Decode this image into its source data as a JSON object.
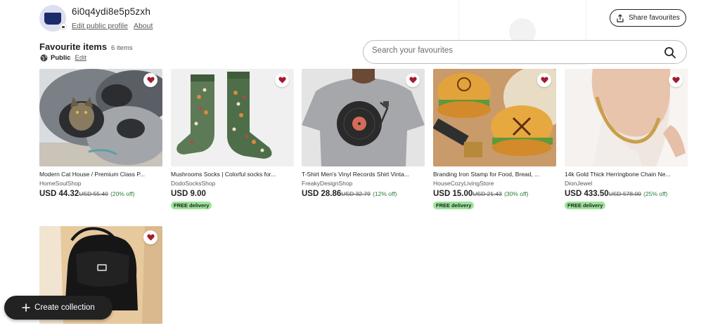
{
  "profile": {
    "username": "6i0q4ydi8e5p5zxh",
    "edit_profile": "Edit public profile",
    "about": "About"
  },
  "share_button": {
    "label": "Share favourites",
    "icon": "share-icon"
  },
  "section": {
    "title": "Favourite items",
    "count": "6 items",
    "visibility": "Public",
    "edit": "Edit"
  },
  "search": {
    "placeholder": "Search your favourites",
    "value": "",
    "icon": "search-icon"
  },
  "items": [
    {
      "title": "Modern Cat House / Premium Class P...",
      "shop": "HomeSoulShop",
      "price": "USD 44.32",
      "original": "USD 55.40",
      "discount": "(20% off)",
      "badge": ""
    },
    {
      "title": "Mushrooms Socks | Colorful socks for...",
      "shop": "DodoSocksShop",
      "price": "USD 9.00",
      "original": "",
      "discount": "",
      "badge": "FREE delivery"
    },
    {
      "title": "T-Shirt Men's Vinyl Records Shirt Vinta...",
      "shop": "FreakyDesignShop",
      "price": "USD 28.86",
      "original": "USD 32.79",
      "discount": "(12% off)",
      "badge": ""
    },
    {
      "title": "Branding Iron Stamp for Food, Bread, ...",
      "shop": "HouseCozyLivingStore",
      "price": "USD 15.00",
      "original": "USD 21.43",
      "discount": "(30% off)",
      "badge": "FREE delivery"
    },
    {
      "title": "14k Gold Thick Herringbone Chain Ne...",
      "shop": "DionJewel",
      "price": "USD 433.50",
      "original": "USD 578.00",
      "discount": "(25% off)",
      "badge": "FREE delivery"
    }
  ],
  "create_button": {
    "label": "Create collection"
  },
  "colors": {
    "heart": "#a61a2e",
    "badge_bg": "#9be49b",
    "accent": "#222222"
  }
}
